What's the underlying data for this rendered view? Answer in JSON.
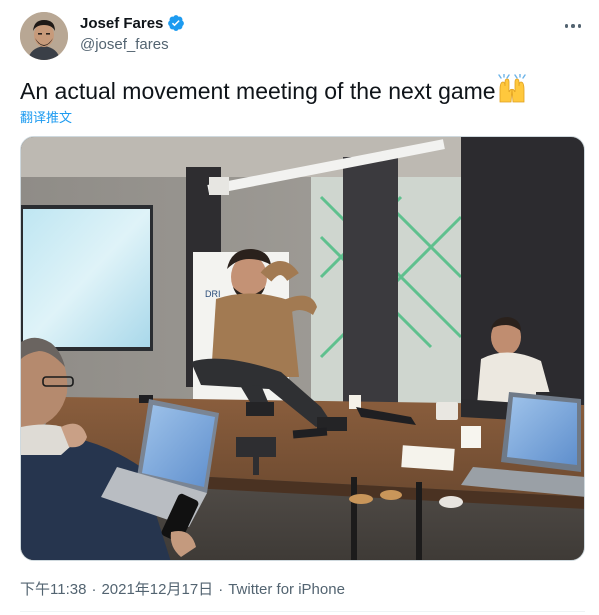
{
  "author": {
    "display_name": "Josef Fares",
    "handle": "@josef_fares",
    "verified": true
  },
  "tweet": {
    "text": "An actual movement meeting of the next game",
    "emoji": "raising-hands-emoji",
    "translate_label": "翻译推文"
  },
  "meta": {
    "time": "下午11:38",
    "separator": "·",
    "date": "2021年12月17日",
    "separator2": "·",
    "source": "Twitter for iPhone"
  },
  "colors": {
    "accent": "#1d9bf0",
    "text_primary": "#0f1419",
    "text_secondary": "#536471"
  },
  "icons": {
    "verified": "verified-badge-icon",
    "more": "more-options-icon"
  }
}
